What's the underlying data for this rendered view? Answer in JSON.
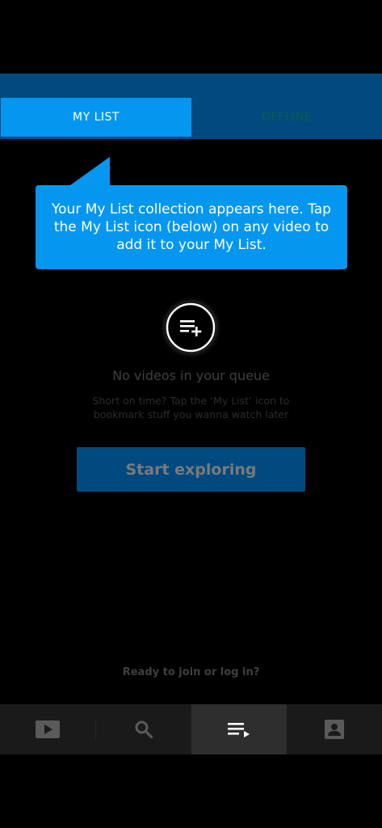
{
  "tabs": {
    "my_list": "MY LIST",
    "offline": "OFFLINE",
    "active": "my_list"
  },
  "tooltip": {
    "text": "Your My List collection appears here. Tap the My List icon (below) on any video to add it to your My List."
  },
  "empty_state": {
    "icon": "list-add-icon",
    "title": "No videos in your queue",
    "description": "Short on time? Tap the ‘My List’ icon to bookmark stuff you wanna watch later",
    "button_label": "Start exploring"
  },
  "join_prompt": "Ready to join or log in?",
  "bottom_nav": {
    "items": [
      {
        "id": "home",
        "icon": "play-icon"
      },
      {
        "id": "search",
        "icon": "search-icon"
      },
      {
        "id": "my-list",
        "icon": "playlist-icon",
        "active": true
      },
      {
        "id": "profile",
        "icon": "account-icon"
      }
    ]
  },
  "colors": {
    "accent": "#0597f0",
    "tab_bar": "#004a7f",
    "background": "#000000",
    "nav_background": "#1a1a1a",
    "nav_active": "#2e2e2e"
  }
}
